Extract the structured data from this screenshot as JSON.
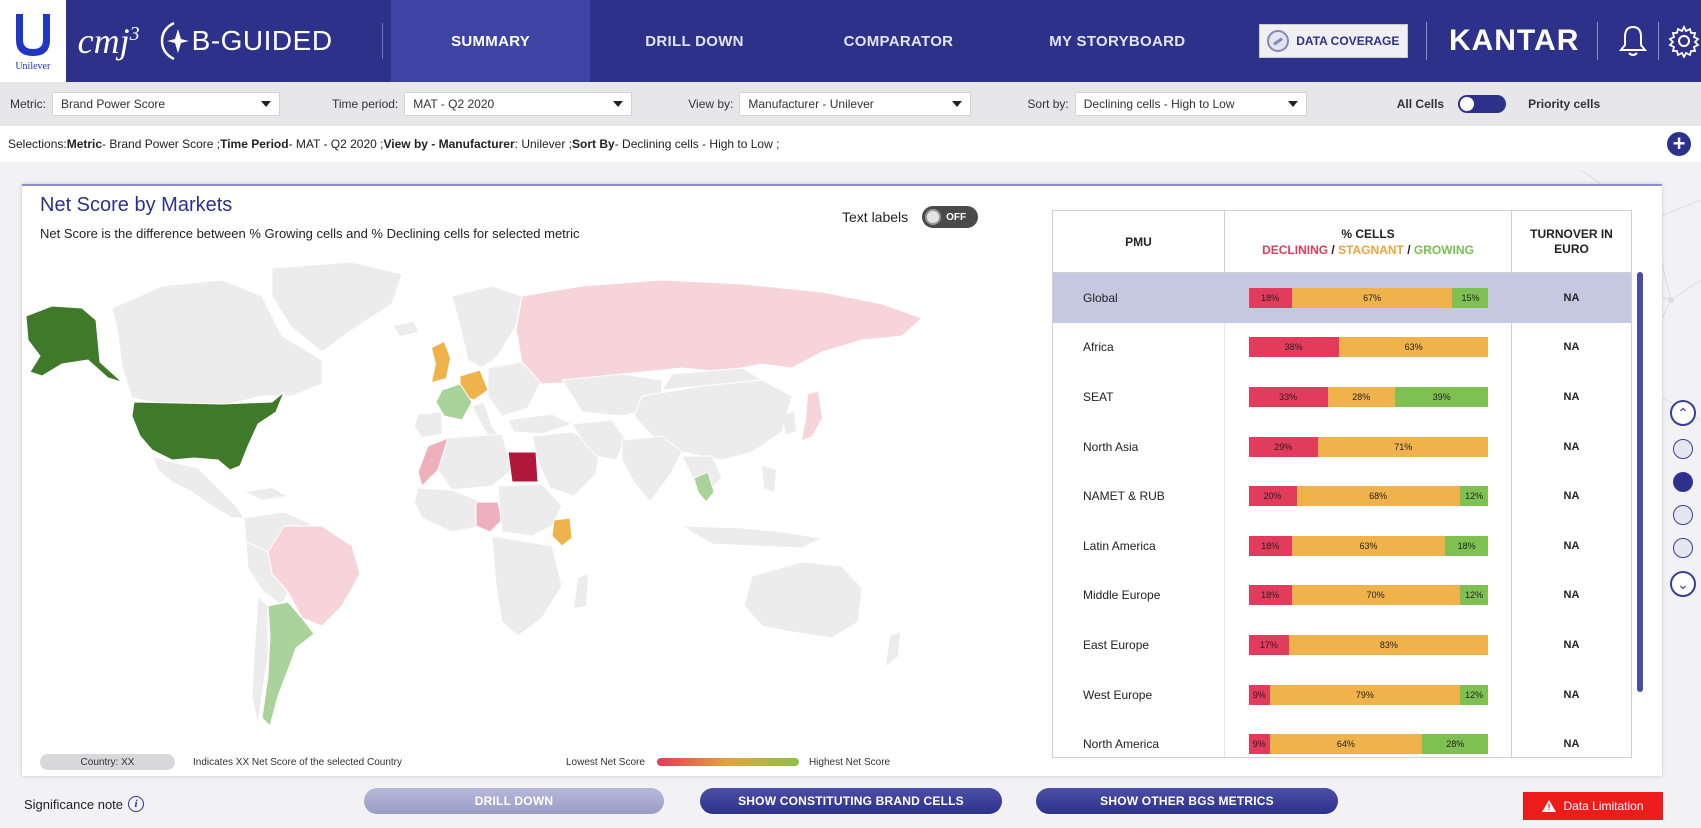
{
  "header": {
    "unilever_label": "Unilever",
    "cmj_label": "cmj",
    "cmj_sup": "3",
    "product_label": "B-GUIDED",
    "tabs": [
      {
        "label": "SUMMARY",
        "active": true
      },
      {
        "label": "DRILL DOWN",
        "active": false
      },
      {
        "label": "COMPARATOR",
        "active": false
      },
      {
        "label": "MY STORYBOARD",
        "active": false
      }
    ],
    "data_coverage_label": "DATA COVERAGE",
    "kantar_label": "KANTAR",
    "icons": [
      "bell-icon",
      "gear-icon"
    ],
    "bar_color": "#2e3189"
  },
  "filters": {
    "metric_label": "Metric:",
    "metric_value": "Brand Power Score",
    "time_label": "Time period:",
    "time_value": "MAT - Q2 2020",
    "view_label": "View by:",
    "view_value": "Manufacturer - Unilever",
    "sort_label": "Sort by:",
    "sort_value": "Declining cells - High to Low",
    "all_cells_label": "All Cells",
    "priority_cells_label": "Priority cells"
  },
  "selections": {
    "prefix": "Selections: ",
    "metric_key": "Metric",
    "metric_val": " - Brand Power Score ; ",
    "time_key": "Time Period",
    "time_val": " - MAT - Q2 2020 ; ",
    "view_key": "View by - Manufacturer",
    "view_val": " : Unilever ; ",
    "sort_key": "Sort By",
    "sort_val": " - Declining cells - High to Low ;"
  },
  "panel": {
    "title": "Net Score by Markets",
    "subtitle": "Net Score is the difference between % Growing cells and % Declining cells for selected metric",
    "text_labels_label": "Text labels",
    "toggle_state": "OFF"
  },
  "legend": {
    "chip_label": "Country: XX",
    "note": "Indicates XX Net Score of the selected Country",
    "low_label": "Lowest Net Score",
    "high_label": "Highest Net Score"
  },
  "table": {
    "col_pmu": "PMU",
    "col_cells": "% CELLS",
    "legend_declining": "DECLINING",
    "legend_stagnant": "STAGNANT",
    "legend_growing": "GROWING",
    "legend_sep": " / ",
    "col_turnover_line1": "TURNOVER IN",
    "col_turnover_line2": "EURO",
    "colors": {
      "declining": "#e33b5b",
      "stagnant": "#f0b24a",
      "growing": "#7ec152"
    },
    "rows": [
      {
        "pmu": "Global",
        "declining": 18,
        "stagnant": 67,
        "growing": 15,
        "dec_label": "18%",
        "stag_label": "67%",
        "grow_label": "15%",
        "turnover": "NA",
        "selected": true
      },
      {
        "pmu": "Africa",
        "declining": 38,
        "stagnant": 63,
        "growing": 0,
        "dec_label": "38%",
        "stag_label": "63%",
        "grow_label": "",
        "turnover": "NA",
        "selected": false
      },
      {
        "pmu": "SEAT",
        "declining": 33,
        "stagnant": 28,
        "growing": 39,
        "dec_label": "33%",
        "stag_label": "28%",
        "grow_label": "39%",
        "turnover": "NA",
        "selected": false
      },
      {
        "pmu": "North Asia",
        "declining": 29,
        "stagnant": 71,
        "growing": 0,
        "dec_label": "29%",
        "stag_label": "71%",
        "grow_label": "",
        "turnover": "NA",
        "selected": false
      },
      {
        "pmu": "NAMET & RUB",
        "declining": 20,
        "stagnant": 68,
        "growing": 12,
        "dec_label": "20%",
        "stag_label": "68%",
        "grow_label": "12%",
        "turnover": "NA",
        "selected": false
      },
      {
        "pmu": "Latin America",
        "declining": 18,
        "stagnant": 63,
        "growing": 18,
        "dec_label": "18%",
        "stag_label": "63%",
        "grow_label": "18%",
        "turnover": "NA",
        "selected": false
      },
      {
        "pmu": "Middle Europe",
        "declining": 18,
        "stagnant": 70,
        "growing": 12,
        "dec_label": "18%",
        "stag_label": "70%",
        "grow_label": "12%",
        "turnover": "NA",
        "selected": false
      },
      {
        "pmu": "East Europe",
        "declining": 17,
        "stagnant": 83,
        "growing": 0,
        "dec_label": "17%",
        "stag_label": "83%",
        "grow_label": "",
        "turnover": "NA",
        "selected": false
      },
      {
        "pmu": "West Europe",
        "declining": 9,
        "stagnant": 79,
        "growing": 12,
        "dec_label": "9%",
        "stag_label": "79%",
        "grow_label": "12%",
        "turnover": "NA",
        "selected": false
      },
      {
        "pmu": "North America",
        "declining": 9,
        "stagnant": 64,
        "growing": 28,
        "dec_label": "9%",
        "stag_label": "64%",
        "grow_label": "28%",
        "turnover": "NA",
        "selected": false
      }
    ]
  },
  "map_colors": {
    "base": "#ececed",
    "light_red": "#f7d3da",
    "dark_red": "#b0173a",
    "dark_green": "#3f7a2a",
    "light_green": "#a9d39a",
    "orange": "#f0b24a",
    "pink_mid": "#efb0bd"
  },
  "side_nav": {
    "up_icon": "chevron-up-icon",
    "down_icon": "chevron-down-icon",
    "dots": 4,
    "active_dot": 1
  },
  "footer": {
    "significance_label": "Significance note",
    "drill_down_button": "DRILL DOWN",
    "brand_cells_button": "SHOW CONSTITUTING BRAND CELLS",
    "other_metrics_button": "SHOW OTHER BGS METRICS",
    "data_limitation_button": "Data Limitation"
  }
}
